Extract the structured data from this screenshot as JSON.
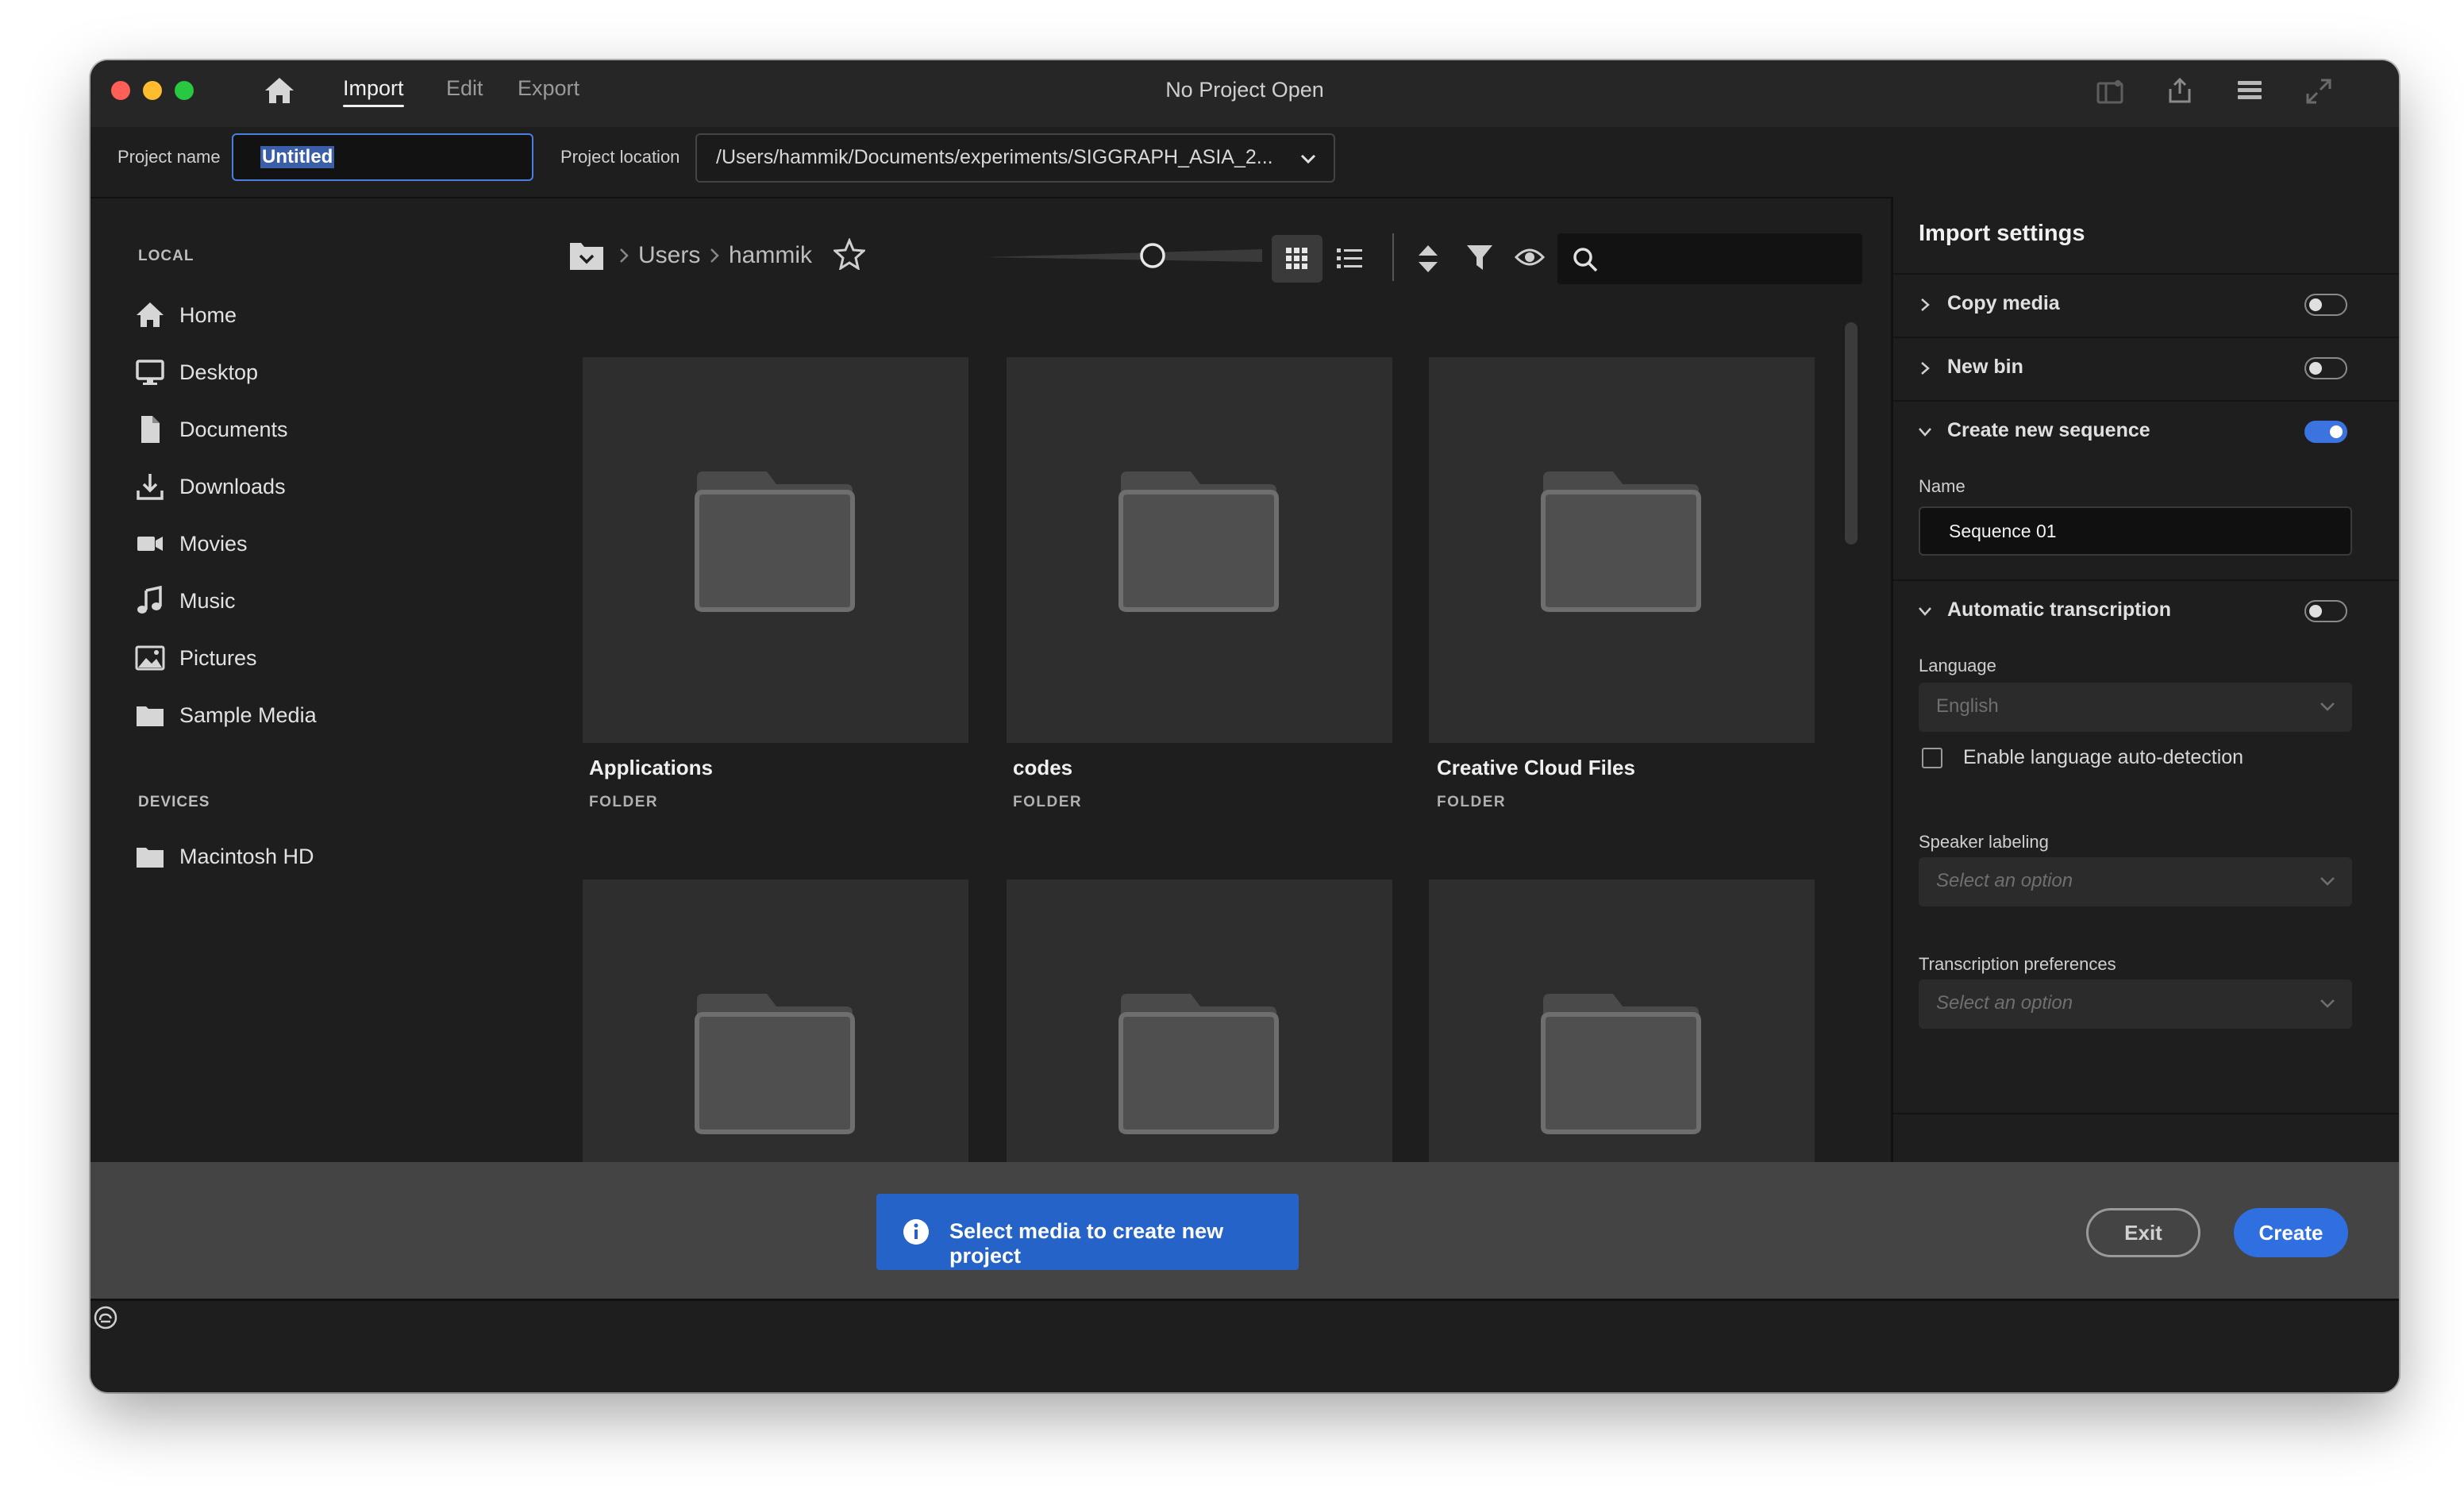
{
  "window": {
    "title": "No Project Open"
  },
  "menu": {
    "tabs": [
      {
        "label": "Import"
      },
      {
        "label": "Edit"
      },
      {
        "label": "Export"
      }
    ],
    "active_tab": "Import"
  },
  "project": {
    "name_label": "Project name",
    "name_value": "Untitled",
    "location_label": "Project location",
    "location_value": "/Users/hammik/Documents/experiments/SIGGRAPH_ASIA_2..."
  },
  "sidebar": {
    "local_heading": "LOCAL",
    "local_items": [
      {
        "label": "Home",
        "icon": "home-icon"
      },
      {
        "label": "Desktop",
        "icon": "desktop-icon"
      },
      {
        "label": "Documents",
        "icon": "document-icon"
      },
      {
        "label": "Downloads",
        "icon": "download-icon"
      },
      {
        "label": "Movies",
        "icon": "video-camera-icon"
      },
      {
        "label": "Music",
        "icon": "music-note-icon"
      },
      {
        "label": "Pictures",
        "icon": "image-icon"
      },
      {
        "label": "Sample Media",
        "icon": "folder-icon"
      }
    ],
    "devices_heading": "DEVICES",
    "device_items": [
      {
        "label": "Macintosh HD",
        "icon": "folder-icon"
      }
    ]
  },
  "browser": {
    "breadcrumb": [
      {
        "label": "Users"
      },
      {
        "label": "hammik"
      }
    ],
    "view_mode": "grid",
    "tiles": [
      {
        "name": "Applications",
        "type": "FOLDER"
      },
      {
        "name": "codes",
        "type": "FOLDER"
      },
      {
        "name": "Creative Cloud Files",
        "type": "FOLDER"
      },
      {
        "name": "",
        "type": ""
      },
      {
        "name": "",
        "type": ""
      },
      {
        "name": "",
        "type": ""
      }
    ]
  },
  "import_settings": {
    "title": "Import settings",
    "copy_media": {
      "label": "Copy media",
      "enabled": false
    },
    "new_bin": {
      "label": "New bin",
      "enabled": false
    },
    "create_sequence": {
      "label": "Create new sequence",
      "enabled": true,
      "name_label": "Name",
      "name_value": "Sequence 01"
    },
    "transcription": {
      "label": "Automatic transcription",
      "enabled": false,
      "language_label": "Language",
      "language_value": "English",
      "auto_detect_label": "Enable language auto-detection",
      "auto_detect_checked": false,
      "speaker_label": "Speaker labeling",
      "speaker_placeholder": "Select an option",
      "preferences_label": "Transcription preferences",
      "preferences_placeholder": "Select an option"
    }
  },
  "footer": {
    "message": "Select media to create new project",
    "exit_label": "Exit",
    "create_label": "Create"
  },
  "colors": {
    "accent": "#2f6fdf",
    "toast": "#2563c9",
    "background": "#1e1e1e"
  }
}
